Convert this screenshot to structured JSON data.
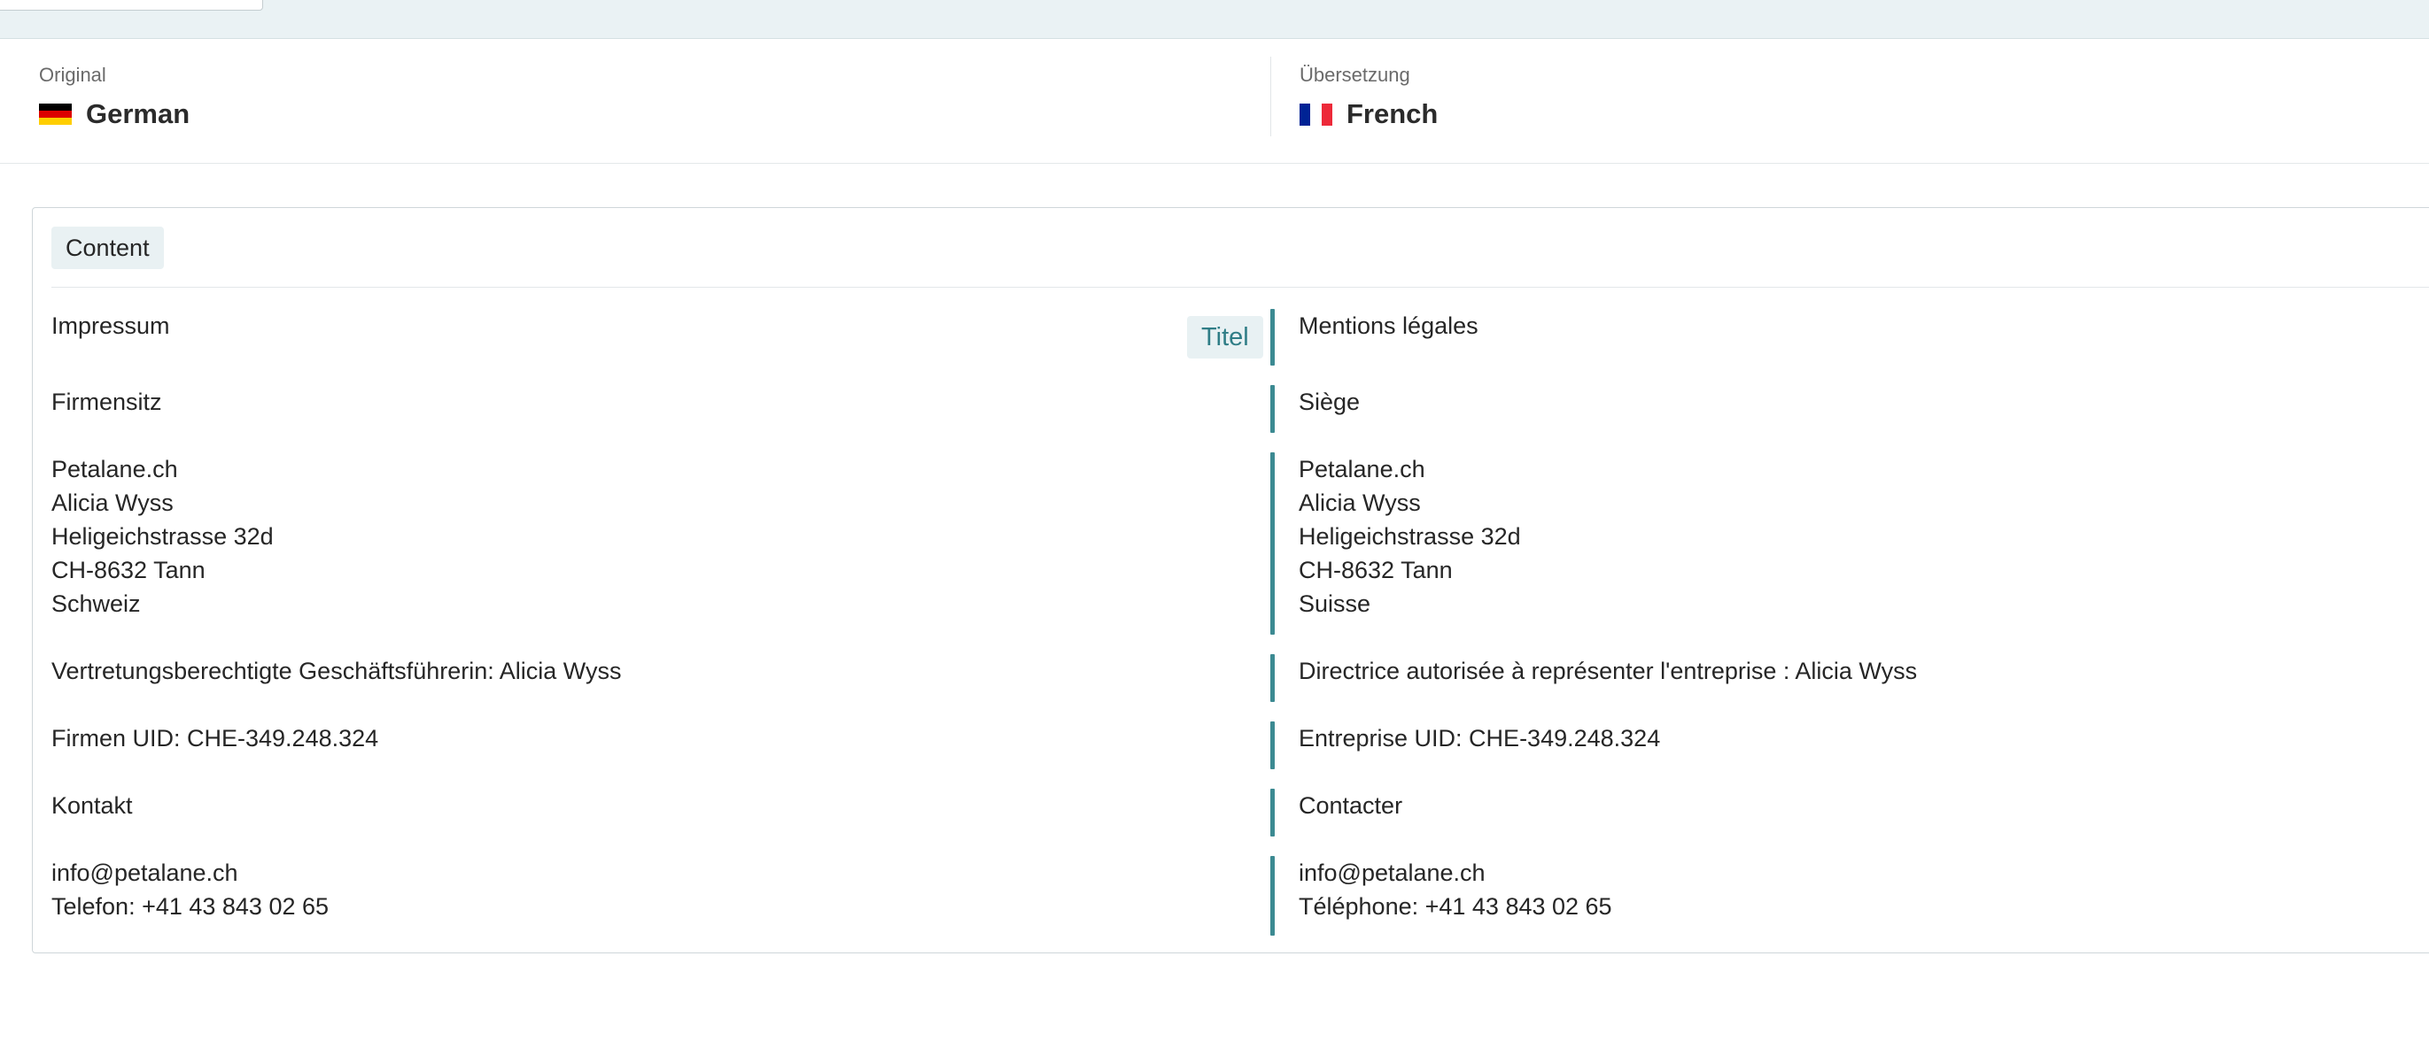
{
  "languages": {
    "source": {
      "caption": "Original",
      "name": "German",
      "flag_icon": "german-flag-icon",
      "flag_colors": [
        "#000000",
        "#dd0000",
        "#ffce00"
      ]
    },
    "target": {
      "caption": "Übersetzung",
      "name": "French",
      "flag_icon": "french-flag-icon",
      "flag_colors": [
        "#002395",
        "#ffffff",
        "#ed2939"
      ]
    }
  },
  "section": {
    "label": "Content"
  },
  "accent_color": "#3c8a92",
  "rows": [
    {
      "source": "Impressum",
      "target": "Mentions légales",
      "tag": "Titel"
    },
    {
      "source": "Firmensitz",
      "target": "Siège"
    },
    {
      "source": "Petalane.ch\nAlicia Wyss\nHeligeichstrasse 32d\nCH-8632 Tann\nSchweiz",
      "target": "Petalane.ch\nAlicia Wyss\nHeligeichstrasse 32d\nCH-8632 Tann\nSuisse"
    },
    {
      "source": "Vertretungsberechtigte Geschäftsführerin: Alicia Wyss",
      "target": "Directrice autorisée à représenter l'entreprise : Alicia Wyss"
    },
    {
      "source": "Firmen UID: CHE-349.248.324",
      "target": "Entreprise UID: CHE-349.248.324"
    },
    {
      "source": "Kontakt",
      "target": "Contacter"
    },
    {
      "source": "info@petalane.ch\nTelefon: +41 43 843 02 65",
      "target": "info@petalane.ch\nTéléphone: +41 43 843 02 65"
    }
  ]
}
